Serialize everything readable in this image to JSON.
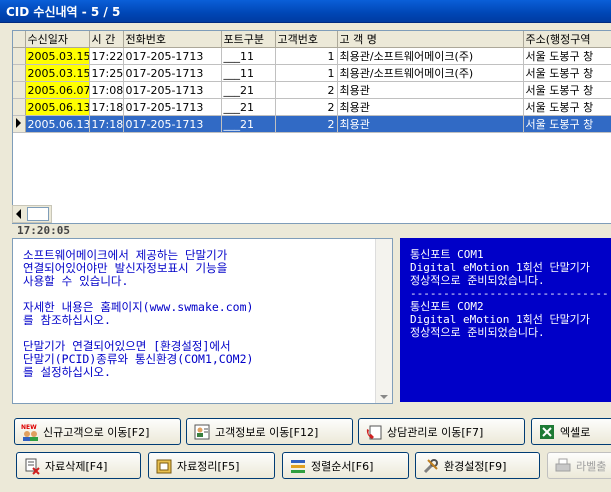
{
  "window": {
    "title": "CID 수신내역 - 5 / 5"
  },
  "grid": {
    "columns": [
      "수신일자",
      "시 간",
      "전화번호",
      "포트구분",
      "고객번호",
      "고 객 명",
      "주소(행정구역"
    ],
    "rows": [
      {
        "date": "2005.03.15",
        "time": "17:22",
        "phone": "017-205-1713",
        "port": "___11",
        "cust_no": "1",
        "name": "최용관/소프트웨어메이크(주)",
        "addr": "서울 도봉구 창",
        "date_hl": true,
        "selected": false
      },
      {
        "date": "2005.03.15",
        "time": "17:25",
        "phone": "017-205-1713",
        "port": "___11",
        "cust_no": "1",
        "name": "최용관/소프트웨어메이크(주)",
        "addr": "서울 도봉구 창",
        "date_hl": true,
        "selected": false
      },
      {
        "date": "2005.06.07",
        "time": "17:08",
        "phone": "017-205-1713",
        "port": "___21",
        "cust_no": "2",
        "name": "최용관",
        "addr": "서울 도봉구 창",
        "date_hl": true,
        "selected": false
      },
      {
        "date": "2005.06.13",
        "time": "17:18",
        "phone": "017-205-1713",
        "port": "___21",
        "cust_no": "2",
        "name": "최용관",
        "addr": "서울 도봉구 창",
        "date_hl": true,
        "selected": false
      },
      {
        "date": "2005.06.13",
        "time": "17:18",
        "phone": "017-205-1713",
        "port": "___21",
        "cust_no": "2",
        "name": "최용관",
        "addr": "서울 도봉구 창",
        "date_hl": false,
        "selected": true
      }
    ]
  },
  "clock": "17:20:05",
  "notice": {
    "text": "소프트웨어메이크에서 제공하는 단말기가\n연결되어있어야만 발신자정보표시 기능을\n사용할 수 있습니다.\n\n자세한 내용은 홈페이지(www.swmake.com)\n를 참조하십시오.\n\n단말기가 연결되어있으면 [환경설정]에서\n단말기(PCID)종류와 통신환경(COM1,COM2)\n를 설정하십시오."
  },
  "port_status": {
    "text": "통신포트 COM1\nDigital eMotion 1회선 단말기가\n정상적으로 준비되었습니다.\n------------------------------\n통신포트 COM2\nDigital eMotion 1회선 단말기가\n정상적으로 준비되었습니다."
  },
  "buttons": {
    "new_customer": "신규고객으로 이동[F2]",
    "customer_info": "고객정보로 이동[F12]",
    "consult": "상담관리로 이동[F7]",
    "excel": "엑셀로",
    "delete": "자료삭제[F4]",
    "organize": "자료정리[F5]",
    "sort": "정렬순서[F6]",
    "settings": "환경설정[F9]",
    "label_print": "라벨출"
  },
  "icons": {
    "new_badge": "NEW"
  },
  "colors": {
    "title_bar": "#0046B5",
    "selection": "#316AC5",
    "date_highlight": "#FFFF00",
    "port_panel": "#0000C8",
    "notice_text": "#0000C8"
  }
}
